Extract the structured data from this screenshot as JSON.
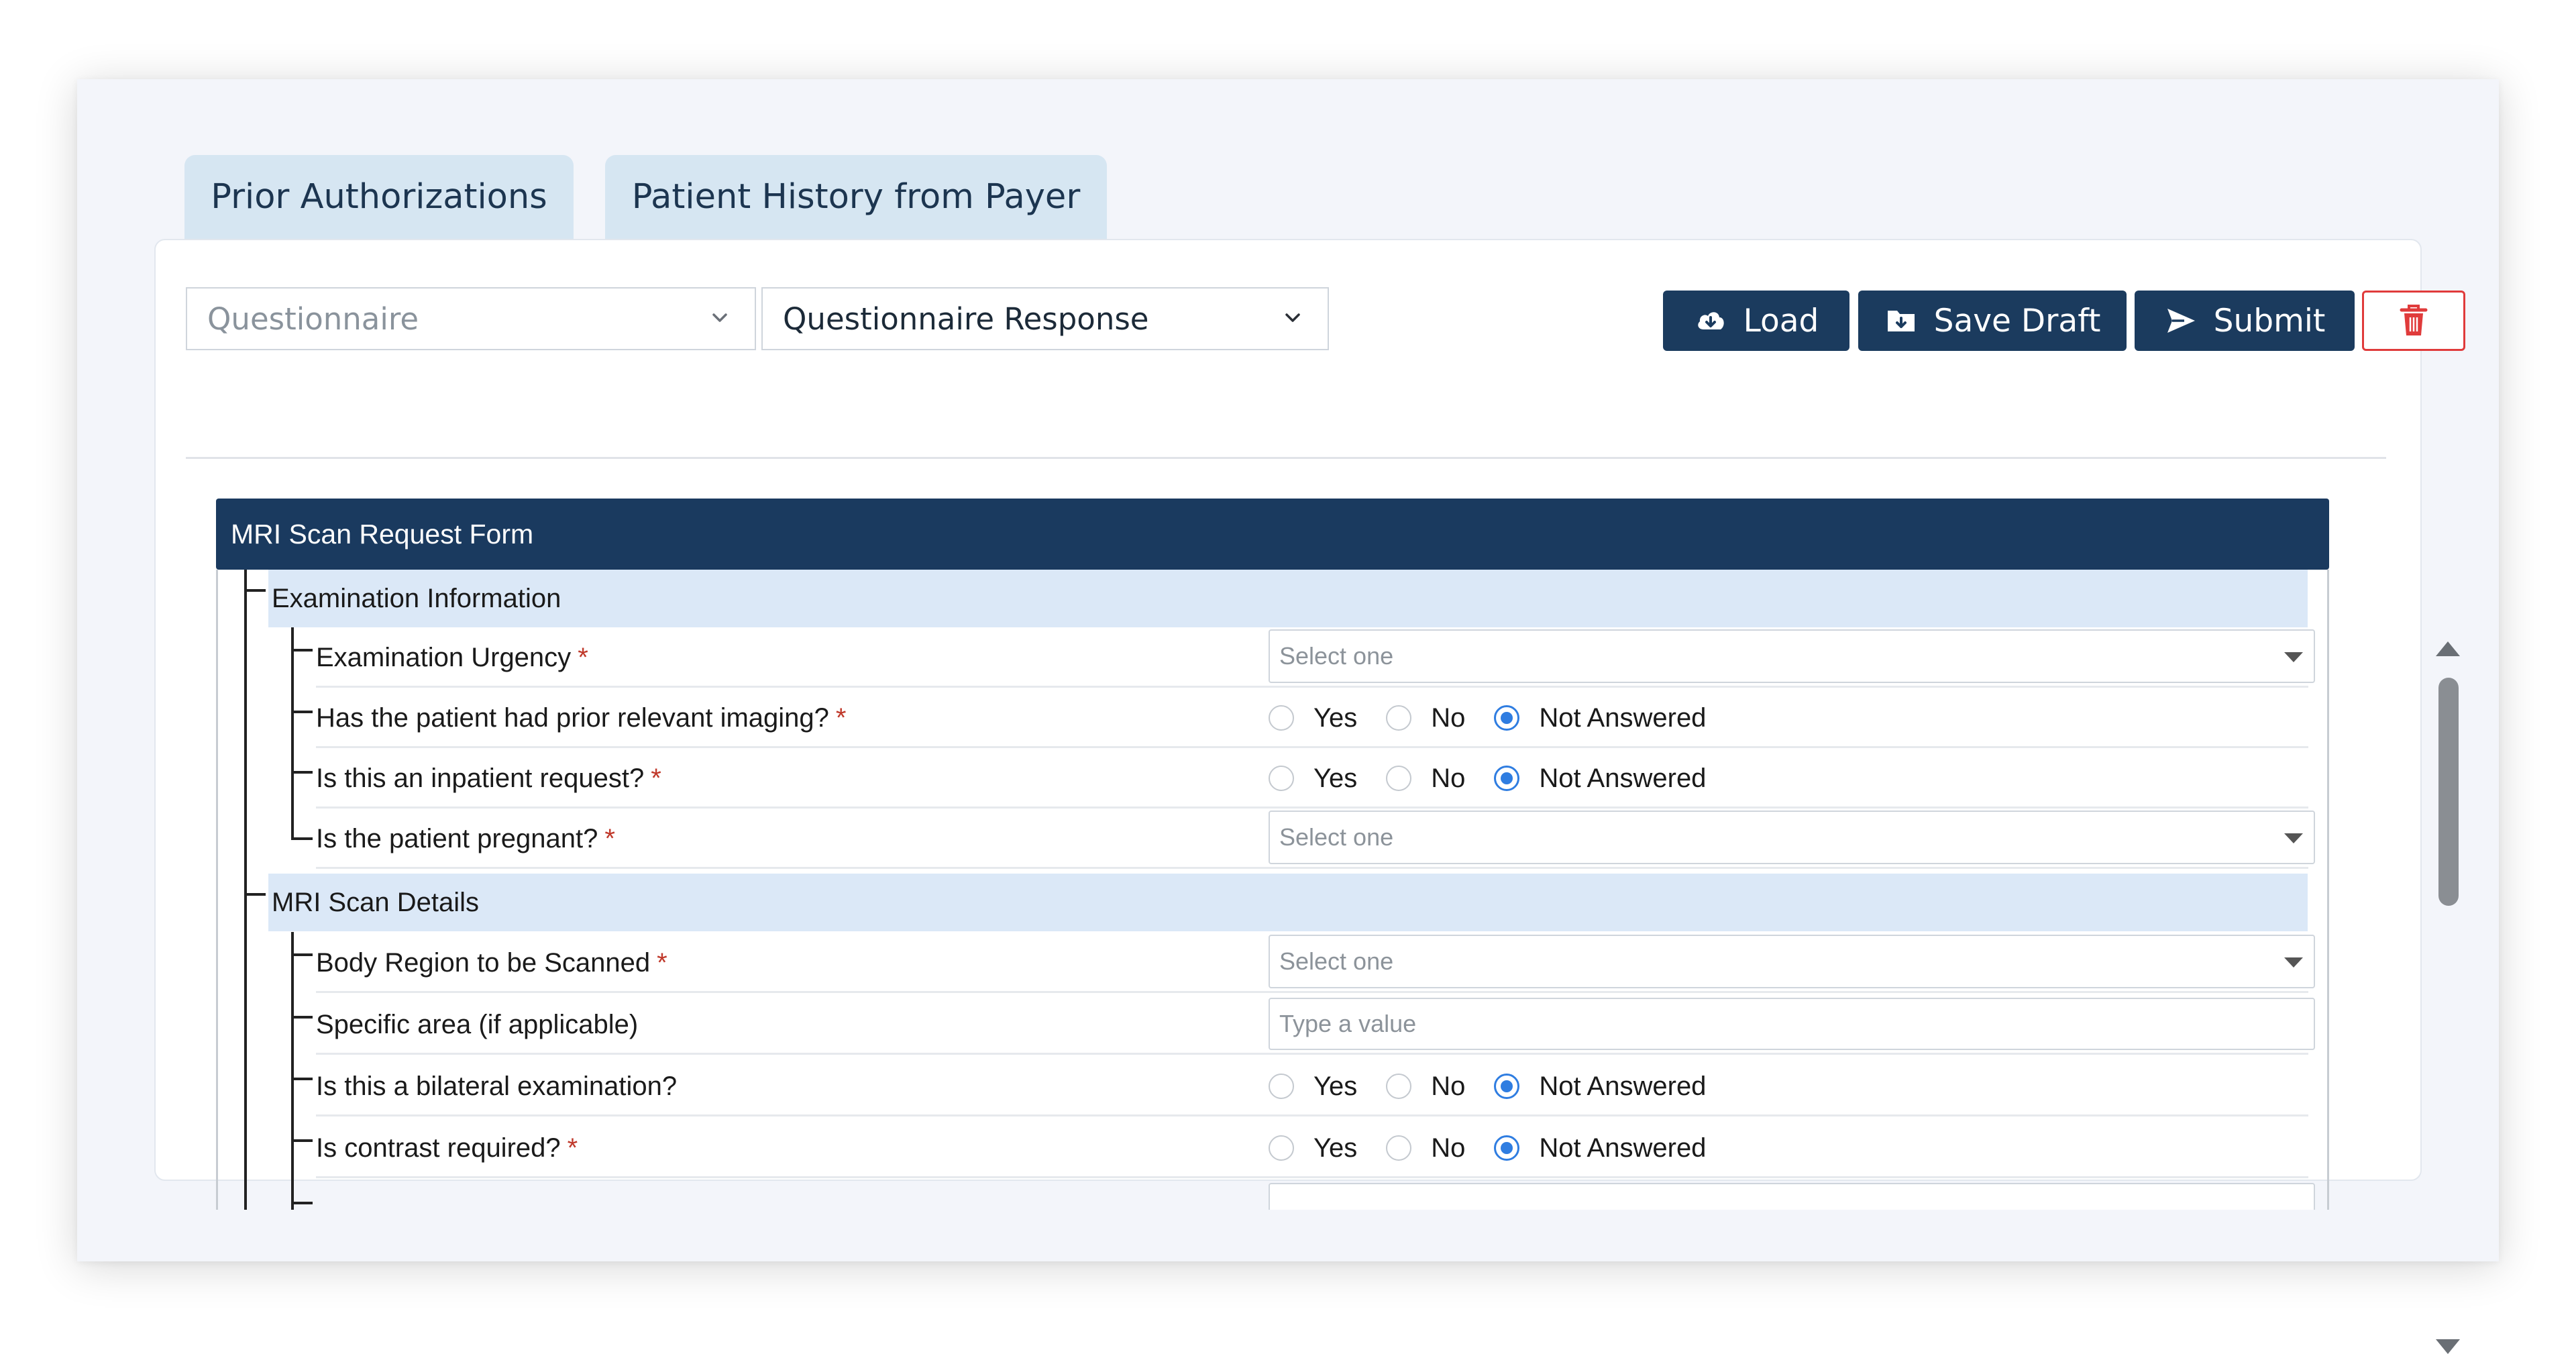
{
  "tabs": [
    {
      "label": "Prior Authorizations"
    },
    {
      "label": "Patient History from Payer"
    }
  ],
  "toolbar": {
    "questionnaire_select": "Questionnaire",
    "response_select": "Questionnaire Response",
    "load_label": "Load",
    "save_draft_label": "Save Draft",
    "submit_label": "Submit"
  },
  "form": {
    "title": "MRI Scan Request Form",
    "sections": [
      {
        "title": "Examination Information"
      },
      {
        "title": "MRI Scan Details"
      }
    ],
    "questions": [
      {
        "label": "Examination Urgency",
        "required": "*",
        "type": "select",
        "placeholder": "Select one"
      },
      {
        "label": "Has the patient had prior relevant imaging?",
        "required": "*",
        "type": "radio",
        "selected": "Not Answered"
      },
      {
        "label": "Is this an inpatient request?",
        "required": "*",
        "type": "radio",
        "selected": "Not Answered"
      },
      {
        "label": "Is the patient pregnant?",
        "required": "*",
        "type": "select",
        "placeholder": "Select one"
      },
      {
        "label": "Body Region to be Scanned",
        "required": "*",
        "type": "select",
        "placeholder": "Select one"
      },
      {
        "label": "Specific area (if applicable)",
        "required": "",
        "type": "text",
        "placeholder": "Type a value"
      },
      {
        "label": "Is this a bilateral examination?",
        "required": "",
        "type": "radio",
        "selected": "Not Answered"
      },
      {
        "label": "Is contrast required?",
        "required": "*",
        "type": "radio",
        "selected": "Not Answered"
      }
    ],
    "radio_options": {
      "yes": "Yes",
      "no": "No",
      "not_answered": "Not Answered"
    }
  },
  "colors": {
    "primary": "#1b3b5e",
    "section_bg": "#dbe8f7",
    "tab_bg": "#d6e6f2",
    "radio_selected": "#2f7de1",
    "danger": "#e03b3b"
  },
  "icons": [
    "chevron-down-icon",
    "cloud-download-icon",
    "folder-save-icon",
    "send-icon",
    "trash-icon",
    "caret-down-icon",
    "scroll-up-arrow-icon",
    "scroll-down-arrow-icon"
  ]
}
